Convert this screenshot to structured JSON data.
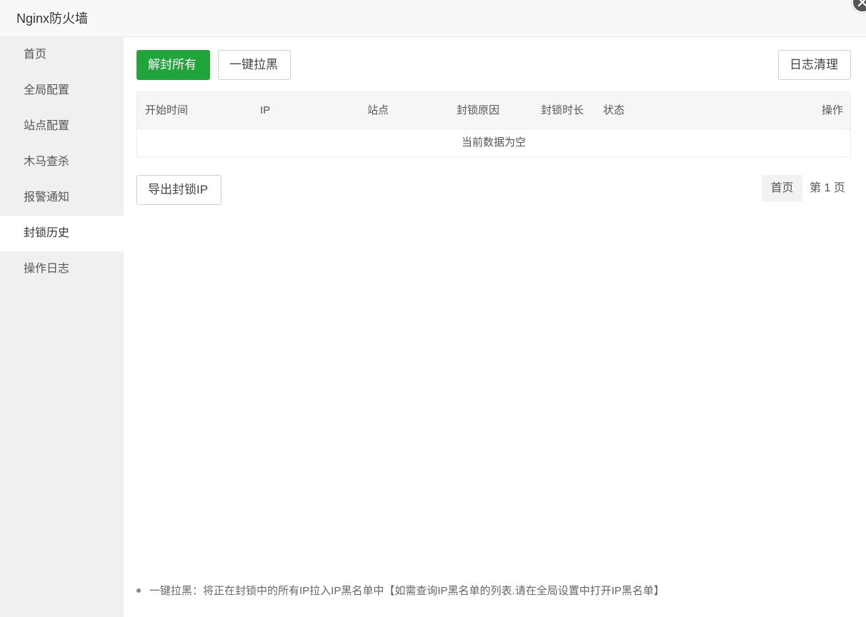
{
  "window": {
    "title": "Nginx防火墙"
  },
  "sidebar": {
    "items": [
      {
        "label": "首页"
      },
      {
        "label": "全局配置"
      },
      {
        "label": "站点配置"
      },
      {
        "label": "木马查杀"
      },
      {
        "label": "报警通知"
      },
      {
        "label": "封锁历史",
        "active": true
      },
      {
        "label": "操作日志"
      }
    ]
  },
  "toolbar": {
    "unblock_all": "解封所有",
    "blacklist_one_click": "一键拉黑",
    "clear_logs": "日志清理"
  },
  "table": {
    "columns": [
      "开始时间",
      "IP",
      "站点",
      "封锁原因",
      "封锁时长",
      "状态",
      "操作"
    ],
    "empty_text": "当前数据为空"
  },
  "export": {
    "label": "导出封锁IP"
  },
  "pagination": {
    "first": "首页",
    "info": "第 1 页"
  },
  "tip": {
    "text": "一键拉黑：将正在封锁中的所有IP拉入IP黑名单中【如需查询IP黑名单的列表.请在全局设置中打开IP黑名单】"
  },
  "colors": {
    "primary": "#20a53a",
    "sidebar_bg": "#f0f0f0",
    "active_item_bg": "#ffffff"
  }
}
